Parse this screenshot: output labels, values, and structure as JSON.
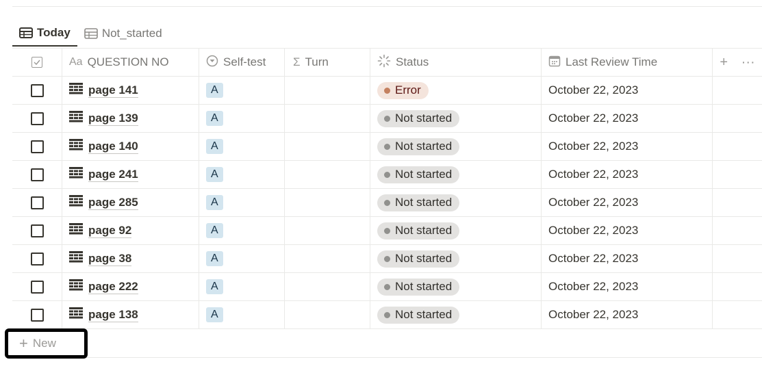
{
  "tabs": [
    {
      "label": "Today",
      "icon": "table-icon",
      "active": true
    },
    {
      "label": "Not_started",
      "icon": "table-icon",
      "active": false
    }
  ],
  "columns": {
    "question": {
      "label": "QUESTION NO",
      "icon": "Aa"
    },
    "self_test": {
      "label": "Self-test",
      "icon": "select-icon"
    },
    "turn": {
      "label": "Turn",
      "icon": "Σ"
    },
    "status": {
      "label": "Status",
      "icon": "status-icon"
    },
    "last_review": {
      "label": "Last Review Time",
      "icon": "calendar-icon"
    },
    "add": "+",
    "more": "···"
  },
  "rows": [
    {
      "question": "page 141",
      "self_test": "A",
      "turn": "",
      "status": "Error",
      "last_review": "October 22, 2023"
    },
    {
      "question": "page 139",
      "self_test": "A",
      "turn": "",
      "status": "Not started",
      "last_review": "October 22, 2023"
    },
    {
      "question": "page 140",
      "self_test": "A",
      "turn": "",
      "status": "Not started",
      "last_review": "October 22, 2023"
    },
    {
      "question": "page 241",
      "self_test": "A",
      "turn": "",
      "status": "Not started",
      "last_review": "October 22, 2023"
    },
    {
      "question": "page 285",
      "self_test": "A",
      "turn": "",
      "status": "Not started",
      "last_review": "October 22, 2023"
    },
    {
      "question": "page 92",
      "self_test": "A",
      "turn": "",
      "status": "Not started",
      "last_review": "October 22, 2023"
    },
    {
      "question": "page 38",
      "self_test": "A",
      "turn": "",
      "status": "Not started",
      "last_review": "October 22, 2023"
    },
    {
      "question": "page 222",
      "self_test": "A",
      "turn": "",
      "status": "Not started",
      "last_review": "October 22, 2023"
    },
    {
      "question": "page 138",
      "self_test": "A",
      "turn": "",
      "status": "Not started",
      "last_review": "October 22, 2023"
    }
  ],
  "new_row": {
    "icon": "+",
    "label": "New"
  },
  "colors": {
    "status_error_bg": "#f4e4dc",
    "status_error_dot": "#c4805f",
    "status_not_started_bg": "#e3e2e0",
    "status_not_started_dot": "#91918e",
    "tag_a_bg": "#d3e5ef"
  }
}
